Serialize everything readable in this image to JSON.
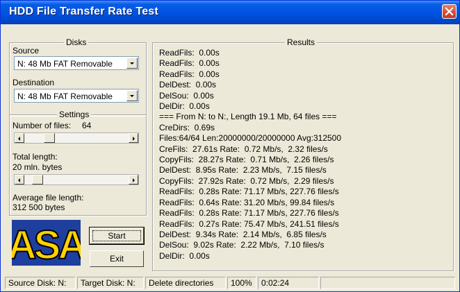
{
  "window": {
    "title": "HDD File Transfer Rate Test"
  },
  "disks": {
    "legend": "Disks",
    "source_label": "Source",
    "source_value": "N:   48 Mb FAT Removable",
    "destination_label": "Destination",
    "destination_value": "N:   48 Mb FAT Removable"
  },
  "settings": {
    "legend": "Settings",
    "num_files_label": "Number of files:",
    "num_files_value": "64",
    "num_files_level": 0.2,
    "total_length_label": "Total length:",
    "total_length_value": "20 mln. bytes",
    "total_length_level": 0.07,
    "avg_label": "Average file length:",
    "avg_value": "312 500 bytes"
  },
  "buttons": {
    "start": "Start",
    "exit": "Exit"
  },
  "logo": {
    "text": "ASA"
  },
  "results": {
    "legend": "Results",
    "lines": [
      "ReadFils:  0.00s",
      "ReadFils:  0.00s",
      "ReadFils:  0.00s",
      "DelDest:  0.00s",
      "DelSou:  0.00s",
      "DelDir:  0.00s",
      "=== From N: to N:, Length 19.1 Mb, 64 files ===",
      "CreDirs:  0.69s",
      "Files:64/64 Len:20000000/20000000 Avg:312500",
      "CreFils:  27.61s Rate:  0.72 Mb/s,  2.32 files/s",
      "CopyFils:  28.27s Rate:  0.71 Mb/s,  2.26 files/s",
      "DelDest:  8.95s Rate:  2.23 Mb/s,  7.15 files/s",
      "CopyFils:  27.92s Rate:  0.72 Mb/s,  2.29 files/s",
      "ReadFils:  0.28s Rate: 71.17 Mb/s, 227.76 files/s",
      "ReadFils:  0.64s Rate: 31.20 Mb/s, 99.84 files/s",
      "ReadFils:  0.28s Rate: 71.17 Mb/s, 227.76 files/s",
      "ReadFils:  0.27s Rate: 75.47 Mb/s, 241.51 files/s",
      "DelDest:  9.34s Rate:  2.14 Mb/s,  6.85 files/s",
      "DelSou:  9.02s Rate:  2.22 Mb/s,  7.10 files/s",
      "DelDir:  0.00s"
    ]
  },
  "statusbar": {
    "source": "Source Disk: N:",
    "target": "Target Disk: N:",
    "action": "Delete directories",
    "percent": "100%",
    "time": "0:02:24",
    "progress": 1.0
  },
  "colors": {
    "titlebar": "#0054e3",
    "face": "#ece9d8",
    "logo_bg": "#1f3f9f",
    "logo_fg": "#ffd200",
    "close": "#d7492a"
  },
  "icons": [
    "close-icon",
    "dropdown-arrow-icon",
    "trackbar-left-arrow-icon",
    "trackbar-right-arrow-icon"
  ]
}
